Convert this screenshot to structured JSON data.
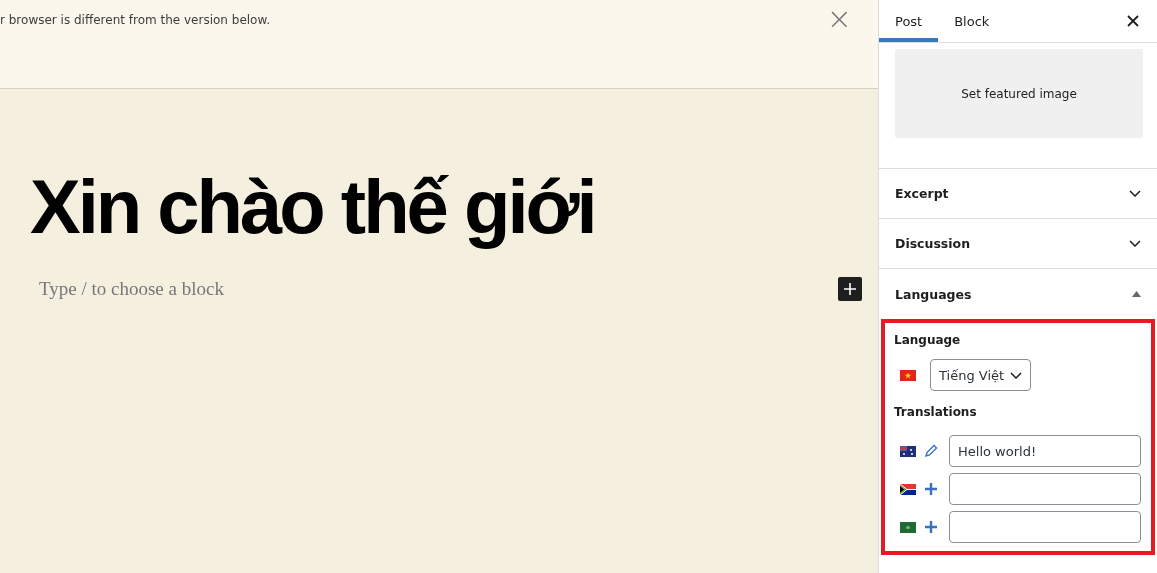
{
  "notice": {
    "text": "r browser is different from the version below.",
    "close": "×"
  },
  "editor": {
    "title": "Xin chào thế giới",
    "block_placeholder": "Type / to choose a block"
  },
  "sidebar": {
    "tabs": [
      {
        "label": "Post",
        "selected": true
      },
      {
        "label": "Block",
        "selected": false
      }
    ],
    "featured_image": "Set featured image",
    "sections": [
      {
        "title": "Excerpt",
        "expanded": false
      },
      {
        "title": "Discussion",
        "expanded": false
      },
      {
        "title": "Languages",
        "expanded": true
      }
    ],
    "languages": {
      "language_label": "Language",
      "language_value": "Tiếng Việt",
      "translations_label": "Translations",
      "translations": [
        {
          "kind": "edit",
          "value": "Hello world!"
        },
        {
          "kind": "add"
        },
        {
          "kind": "add"
        }
      ]
    }
  }
}
